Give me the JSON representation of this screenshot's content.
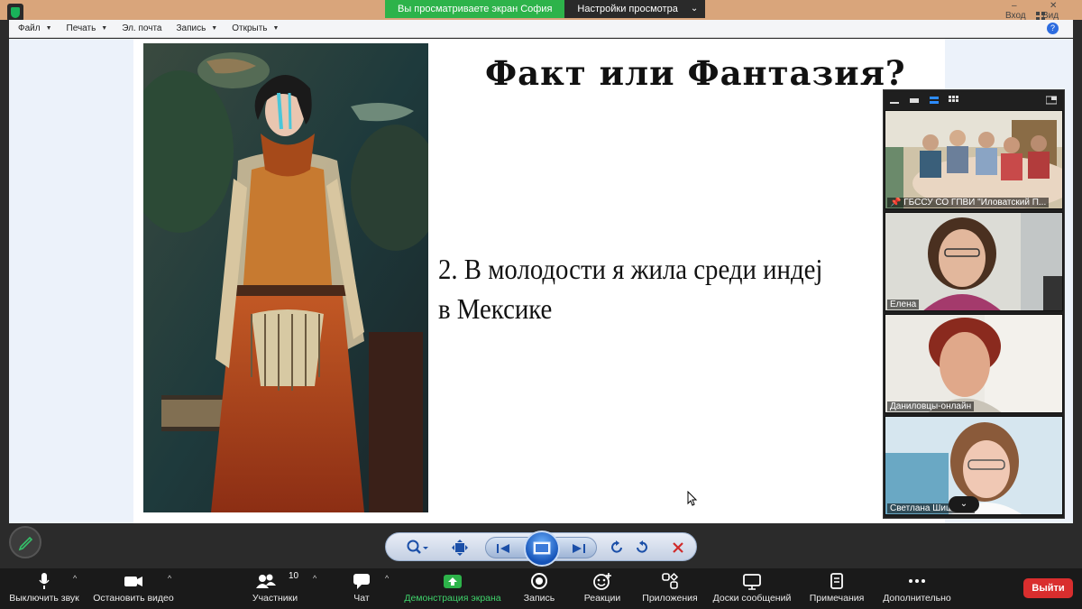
{
  "banner": {
    "viewing_text": "Вы просматриваете экран София",
    "view_options_label": "Настройки просмотра"
  },
  "window": {
    "enter_label": "Вход",
    "view_label": "Вид"
  },
  "menu": {
    "items": [
      {
        "label": "Файл",
        "has_caret": true
      },
      {
        "label": "Печать",
        "has_caret": true
      },
      {
        "label": "Эл. почта",
        "has_caret": false
      },
      {
        "label": "Запись",
        "has_caret": true
      },
      {
        "label": "Открыть",
        "has_caret": true
      }
    ],
    "help_label": "?"
  },
  "slide": {
    "title": "Факт или Фантазия?",
    "text_line1": "2. В молодости я жила среди индеј",
    "text_line2": "в Мексике"
  },
  "gallery": {
    "tiles": [
      {
        "name": "ГБССУ СО ГПВИ \"Иловатский П...",
        "pinned": true
      },
      {
        "name": "Елена",
        "pinned": false
      },
      {
        "name": "Даниловцы-онлайн",
        "pinned": false
      },
      {
        "name": "Светлана Шишкина",
        "pinned": false
      }
    ]
  },
  "toolbar": {
    "mute_label": "Выключить звук",
    "video_label": "Остановить видео",
    "participants_label": "Участники",
    "participants_count": "10",
    "chat_label": "Чат",
    "share_label": "Демонстрация экрана",
    "record_label": "Запись",
    "reactions_label": "Реакции",
    "apps_label": "Приложения",
    "whiteboards_label": "Доски сообщений",
    "notes_label": "Примечания",
    "more_label": "Дополнительно",
    "leave_label": "Выйти"
  },
  "colors": {
    "banner_green": "#2db34a",
    "share_green": "#3fd36b",
    "leave_red": "#d92e2e",
    "top_strip": "#d9a57b"
  }
}
